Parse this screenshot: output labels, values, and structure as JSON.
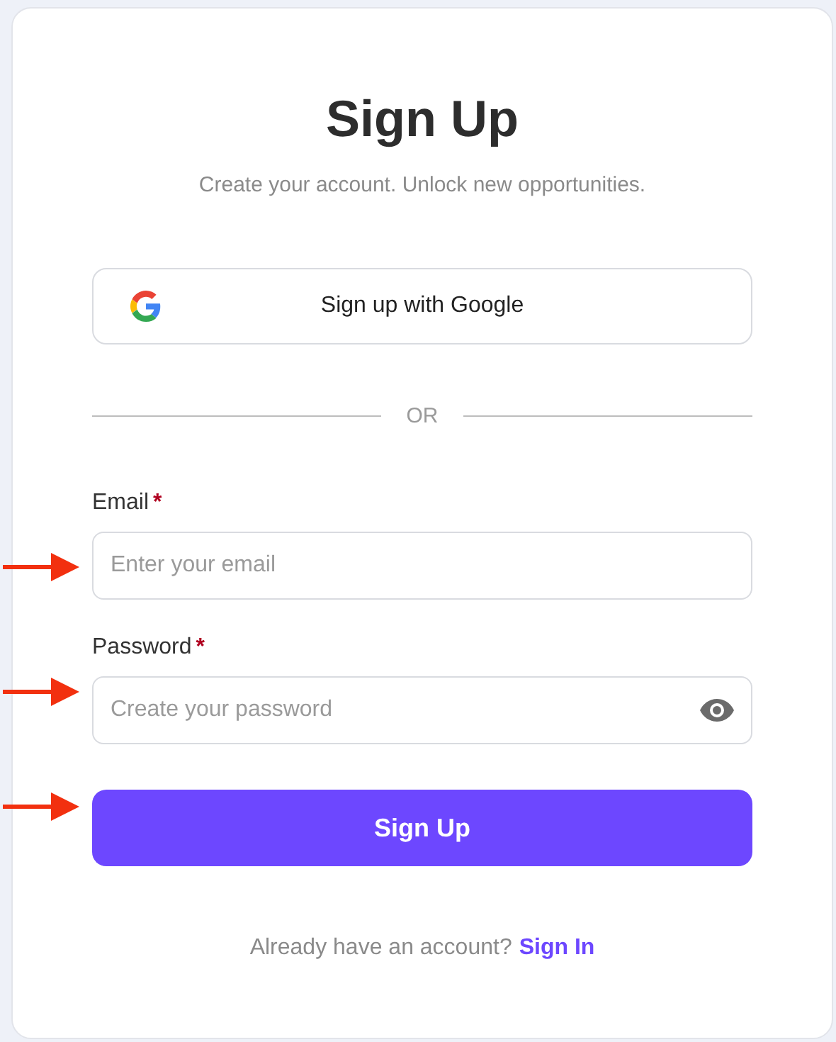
{
  "title": "Sign Up",
  "subtitle": "Create your account. Unlock new opportunities.",
  "google_button": {
    "label": "Sign up with Google"
  },
  "divider_text": "OR",
  "fields": [
    {
      "kind": "email",
      "label": "Email",
      "required_mark": "*",
      "placeholder": "Enter your email"
    },
    {
      "kind": "password",
      "label": "Password",
      "required_mark": "*",
      "placeholder": "Create your password"
    }
  ],
  "submit_button": {
    "label": "Sign Up"
  },
  "footer": {
    "text": "Already have an account?",
    "link": "Sign In"
  }
}
